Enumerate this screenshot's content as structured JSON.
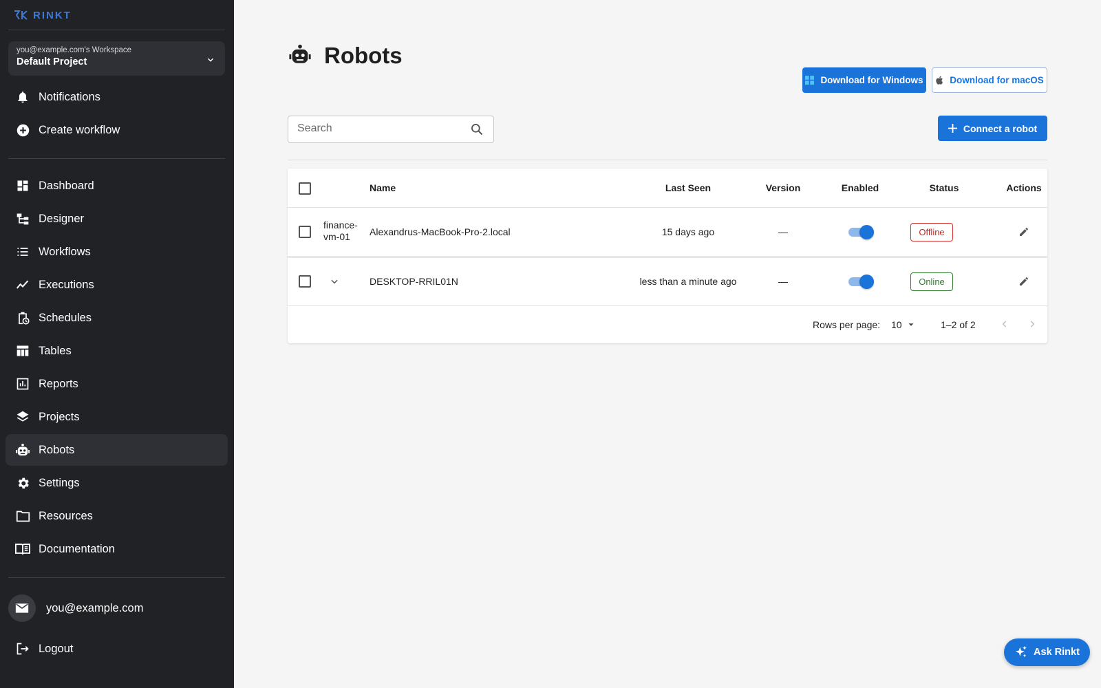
{
  "app": {
    "logo_text": "RINKT"
  },
  "colors": {
    "accent": "#1a73d9",
    "sidebar_bg": "#202226",
    "offline": "#c62828",
    "online": "#2e7d32"
  },
  "workspace": {
    "owner": "you@example.com's Workspace",
    "project": "Default Project"
  },
  "sidebar": {
    "top_items": [
      {
        "label": "Notifications",
        "icon": "bell-icon"
      },
      {
        "label": "Create workflow",
        "icon": "plus-circle-icon"
      }
    ],
    "items": [
      {
        "label": "Dashboard",
        "icon": "dashboard-icon"
      },
      {
        "label": "Designer",
        "icon": "designer-icon"
      },
      {
        "label": "Workflows",
        "icon": "list-icon"
      },
      {
        "label": "Executions",
        "icon": "trend-line-icon"
      },
      {
        "label": "Schedules",
        "icon": "clipboard-clock-icon"
      },
      {
        "label": "Tables",
        "icon": "table-icon"
      },
      {
        "label": "Reports",
        "icon": "bar-chart-icon"
      },
      {
        "label": "Projects",
        "icon": "layers-icon"
      },
      {
        "label": "Robots",
        "icon": "robot-icon",
        "active": true
      },
      {
        "label": "Settings",
        "icon": "gear-icon"
      },
      {
        "label": "Resources",
        "icon": "folder-icon"
      },
      {
        "label": "Documentation",
        "icon": "book-icon"
      }
    ],
    "user_email": "you@example.com",
    "logout_label": "Logout"
  },
  "page": {
    "title": "Robots",
    "download_windows": "Download for Windows",
    "download_macos": "Download for macOS",
    "search_placeholder": "Search",
    "connect_label": "Connect a robot"
  },
  "table": {
    "columns": [
      "Name",
      "Last Seen",
      "Version",
      "Enabled",
      "Status",
      "Actions"
    ],
    "rows": [
      {
        "group": "finance-vm-01",
        "group_line1": "finance-",
        "group_line2": "vm-01",
        "name": "Alexandrus-MacBook-Pro-2.local",
        "last_seen": "15 days ago",
        "version": "—",
        "enabled": true,
        "status": "Offline"
      },
      {
        "group": "",
        "name": "DESKTOP-RRIL01N",
        "last_seen": "less than a minute ago",
        "version": "—",
        "enabled": true,
        "status": "Online"
      }
    ],
    "footer": {
      "rows_per_page_label": "Rows per page:",
      "rows_per_page": "10",
      "range": "1–2 of 2"
    }
  },
  "assistant": {
    "label": "Ask Rinkt"
  }
}
